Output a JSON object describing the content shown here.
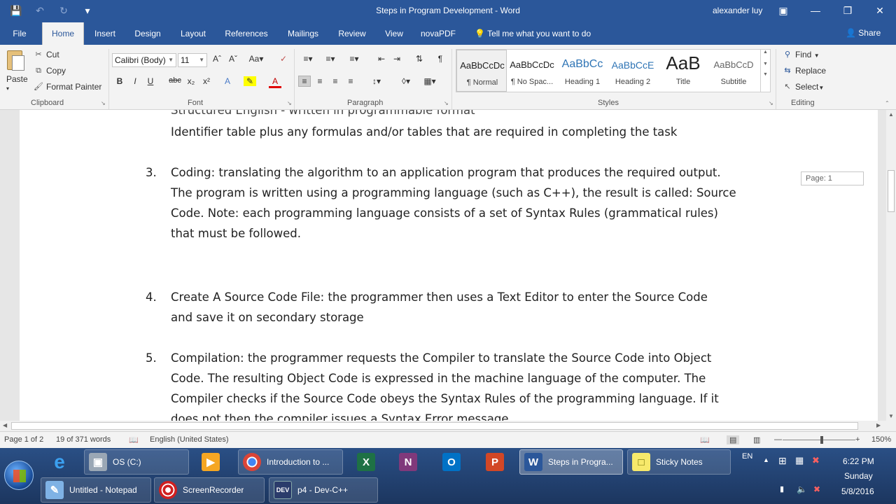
{
  "window": {
    "title": "Steps in Program Development - Word",
    "user": "alexander luy"
  },
  "tabs": [
    "File",
    "Home",
    "Insert",
    "Design",
    "Layout",
    "References",
    "Mailings",
    "Review",
    "View",
    "novaPDF"
  ],
  "tell_me": "Tell me what you want to do",
  "share": "Share",
  "clipboard": {
    "paste": "Paste",
    "cut": "Cut",
    "copy": "Copy",
    "format_painter": "Format Painter",
    "label": "Clipboard"
  },
  "font": {
    "name": "Calibri (Body)",
    "size": "11",
    "label": "Font"
  },
  "paragraph": {
    "label": "Paragraph"
  },
  "styles": {
    "label": "Styles",
    "items": [
      {
        "preview": "AaBbCcDc",
        "name": "¶ Normal"
      },
      {
        "preview": "AaBbCcDc",
        "name": "¶ No Spac..."
      },
      {
        "preview": "AaBbCc",
        "name": "Heading 1"
      },
      {
        "preview": "AaBbCcE",
        "name": "Heading 2"
      },
      {
        "preview": "AaB",
        "name": "Title"
      },
      {
        "preview": "AaBbCcD",
        "name": "Subtitle"
      }
    ]
  },
  "editing": {
    "find": "Find",
    "replace": "Replace",
    "select": "Select",
    "label": "Editing"
  },
  "document": {
    "partial_line": "Structured English - written in programmable format",
    "identifier_line": "Identifier table plus any formulas and/or tables that are required in completing the task",
    "items": [
      {
        "number": "3.",
        "lines": [
          "Coding: translating the algorithm to an application program that produces the required output.",
          "The program is written using a programming language (such as C++), the result is called: Source",
          "Code. Note: each programming language consists of a set of Syntax Rules (grammatical rules)",
          "that must be followed."
        ]
      },
      {
        "number": "4.",
        "lines": [
          "Create A Source Code File: the programmer then uses a Text Editor to enter the Source Code",
          "and save it on secondary storage"
        ]
      },
      {
        "number": "5.",
        "lines": [
          "Compilation: the programmer requests the Compiler to translate the Source Code into Object",
          "Code. The resulting Object Code is expressed in the machine language of the computer. The",
          "Compiler checks if the Source Code obeys the Syntax Rules of the programming language. If it",
          "does not then the compiler issues a Syntax Error message."
        ]
      }
    ],
    "page_tip": "Page: 1"
  },
  "status": {
    "page": "Page 1 of 2",
    "words": "19 of 371 words",
    "language": "English (United States)",
    "zoom": "150%"
  },
  "taskbar": {
    "row1": [
      {
        "label": "OS (C:)",
        "icon": "drive-icon"
      },
      {
        "label": "Introduction to ...",
        "icon": "chrome-icon"
      },
      {
        "label": "Steps in Progra...",
        "icon": "word-icon"
      },
      {
        "label": "Sticky Notes",
        "icon": "sticky-notes-icon"
      }
    ],
    "row2": [
      {
        "label": "Untitled - Notepad",
        "icon": "notepad-icon"
      },
      {
        "label": "ScreenRecorder",
        "icon": "recorder-icon"
      },
      {
        "label": "p4 - Dev-C++",
        "icon": "devcpp-icon"
      }
    ],
    "tray": {
      "lang": "EN",
      "time": "6:22 PM",
      "day": "Sunday",
      "date": "5/8/2016"
    }
  }
}
